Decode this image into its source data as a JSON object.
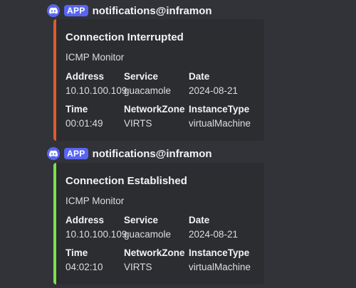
{
  "messages": [
    {
      "badge": "APP",
      "username": "notifications@inframon",
      "bar_color": "#e05a2b",
      "embed": {
        "title": "Connection Interrupted",
        "description": "ICMP Monitor",
        "fields": [
          {
            "name": "Address",
            "value": "10.10.100.109"
          },
          {
            "name": "Service",
            "value": "guacamole"
          },
          {
            "name": "Date",
            "value": "2024-08-21"
          },
          {
            "name": "Time",
            "value": "00:01:49"
          },
          {
            "name": "NetworkZone",
            "value": "VIRTS"
          },
          {
            "name": "InstanceType",
            "value": "virtualMachine"
          }
        ]
      }
    },
    {
      "badge": "APP",
      "username": "notifications@inframon",
      "bar_color": "#7ee04a",
      "embed": {
        "title": "Connection Established",
        "description": "ICMP Monitor",
        "fields": [
          {
            "name": "Address",
            "value": "10.10.100.109"
          },
          {
            "name": "Service",
            "value": "guacamole"
          },
          {
            "name": "Date",
            "value": "2024-08-21"
          },
          {
            "name": "Time",
            "value": "04:02:10"
          },
          {
            "name": "NetworkZone",
            "value": "VIRTS"
          },
          {
            "name": "InstanceType",
            "value": "virtualMachine"
          }
        ]
      }
    }
  ],
  "icons": {
    "server_icon": "discord-icon"
  }
}
